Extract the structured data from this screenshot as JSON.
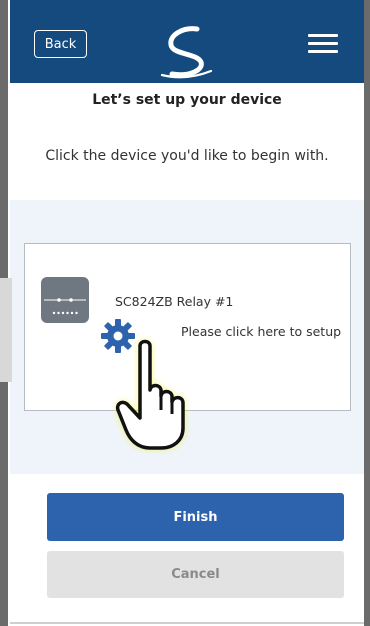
{
  "header": {
    "back_label": "Back",
    "logo_icon": "swirl-logo-icon",
    "menu_icon": "hamburger-menu-icon",
    "background_color": "#154a7f"
  },
  "page": {
    "title": "Let’s set up your device",
    "subtitle": "Click the device you'd like to begin with."
  },
  "device": {
    "name": "SC824ZB Relay #1",
    "setup_hint": "Please click here to setup",
    "device_icon": "relay-device-icon",
    "settings_icon": "gear-icon",
    "pointer_icon": "hand-pointer-icon"
  },
  "actions": {
    "finish_label": "Finish",
    "cancel_label": "Cancel",
    "finish_color": "#2d62ad",
    "cancel_color": "#e2e2e2"
  }
}
